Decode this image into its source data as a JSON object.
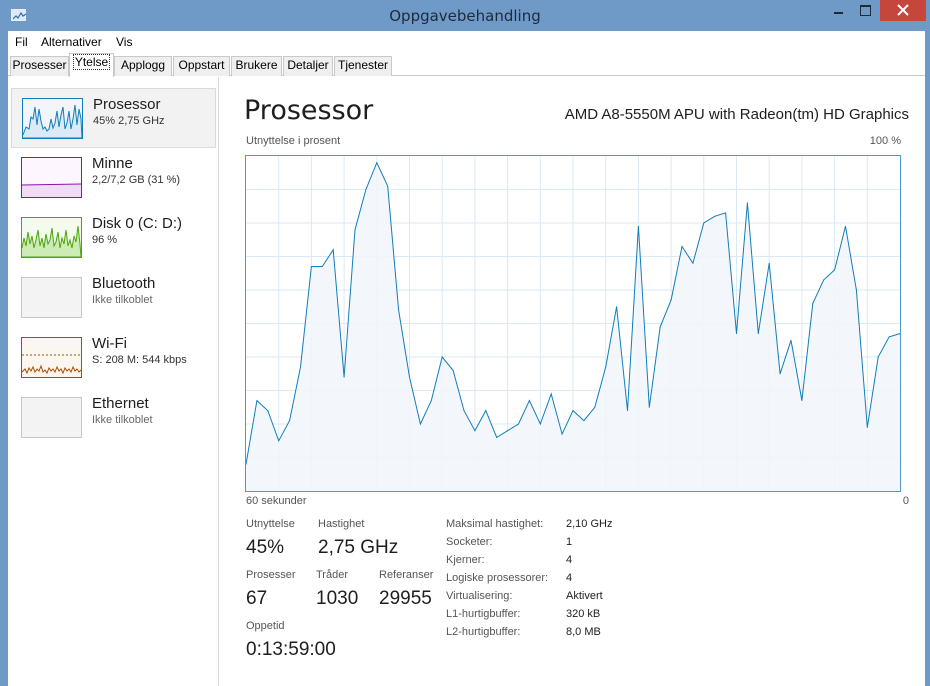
{
  "window": {
    "title": "Oppgavebehandling",
    "icon": "task-manager-icon"
  },
  "menu": [
    "Fil",
    "Alternativer",
    "Vis"
  ],
  "tabs": [
    "Prosesser",
    "Ytelse",
    "Applogg",
    "Oppstart",
    "Brukere",
    "Detaljer",
    "Tjenester"
  ],
  "active_tab": "Ytelse",
  "sidebar": {
    "items": [
      {
        "title": "Prosessor",
        "subtitle": "45% 2,75 GHz",
        "color": "#117dbb"
      },
      {
        "title": "Minne",
        "subtitle": "2,2/7,2 GB (31 %)",
        "color": "#8b12ae"
      },
      {
        "title": "Disk 0 (C: D:)",
        "subtitle": "96 %",
        "color": "#4da60c"
      },
      {
        "title": "Bluetooth",
        "subtitle": "Ikke tilkoblet",
        "color": "#c8c8c8"
      },
      {
        "title": "Wi-Fi",
        "subtitle": "S: 208  M: 544 kbps",
        "color": "#a74f01"
      },
      {
        "title": "Ethernet",
        "subtitle": "Ikke tilkoblet",
        "color": "#c8c8c8"
      }
    ]
  },
  "main": {
    "heading": "Prosessor",
    "model": "AMD A8-5550M APU with Radeon(tm) HD Graphics",
    "graph": {
      "ylabel": "Utnyttelse i prosent",
      "ymax_label": "100 %",
      "xlabel": "60 sekunder",
      "xmin_label": "0",
      "line_color": "#117dbb",
      "fill_color": "#f1f6fa",
      "grid_color": "#d9eaf4"
    },
    "stats": {
      "utilization_label": "Utnyttelse",
      "utilization": "45%",
      "speed_label": "Hastighet",
      "speed": "2,75 GHz",
      "processes_label": "Prosesser",
      "processes": "67",
      "threads_label": "Tråder",
      "threads": "1030",
      "handles_label": "Referanser",
      "handles": "29955",
      "uptime_label": "Oppetid",
      "uptime": "0:13:59:00"
    },
    "specs": [
      {
        "label": "Maksimal hastighet:",
        "value": "2,10 GHz",
        "bold": false
      },
      {
        "label": "Socketer:",
        "value": "1",
        "bold": false
      },
      {
        "label": "Kjerner:",
        "value": "4",
        "bold": false
      },
      {
        "label": "Logiske prosessorer:",
        "value": "4",
        "bold": false
      },
      {
        "label": "Virtualisering:",
        "value": "Aktivert",
        "bold": false
      },
      {
        "label": "L1-hurtigbuffer:",
        "value": "320 kB",
        "bold": false
      },
      {
        "label": "L2-hurtigbuffer:",
        "value": "8,0 MB",
        "bold": false
      }
    ]
  },
  "chart_data": {
    "type": "area",
    "title": "",
    "xlabel": "60 sekunder",
    "ylabel": "Utnyttelse i prosent",
    "ylim": [
      0,
      100
    ],
    "x": [
      60,
      59,
      58,
      57,
      56,
      55,
      54,
      53,
      52,
      51,
      50,
      49,
      48,
      47,
      46,
      45,
      44,
      43,
      42,
      41,
      40,
      39,
      38,
      37,
      36,
      35,
      34,
      33,
      32,
      31,
      30,
      29,
      28,
      27,
      26,
      25,
      24,
      23,
      22,
      21,
      20,
      19,
      18,
      17,
      16,
      15,
      14,
      13,
      12,
      11,
      10,
      9,
      8,
      7,
      6,
      5,
      4,
      3,
      2,
      1,
      0
    ],
    "values": [
      8,
      27,
      24,
      15,
      21,
      37,
      67,
      67,
      72,
      34,
      78,
      90,
      98,
      91,
      54,
      34,
      20,
      27,
      40,
      36,
      24,
      18,
      24,
      16,
      18,
      20,
      27,
      20,
      29,
      17,
      24,
      21,
      25,
      37,
      55,
      24,
      79,
      25,
      49,
      57,
      73,
      68,
      80,
      82,
      83,
      47,
      86,
      47,
      68,
      35,
      45,
      27,
      56,
      63,
      66,
      79,
      60,
      19,
      40,
      46,
      47
    ]
  }
}
